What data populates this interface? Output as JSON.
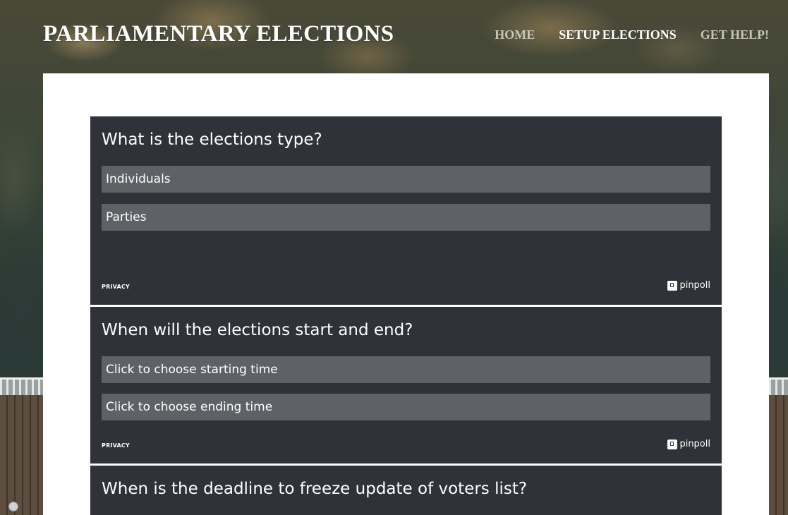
{
  "header": {
    "title": "PARLIAMENTARY ELECTIONS",
    "nav": [
      {
        "label": "HOME",
        "active": false
      },
      {
        "label": "SETUP ELECTIONS",
        "active": true
      },
      {
        "label": "GET HELP!",
        "active": false
      }
    ]
  },
  "polls": [
    {
      "question": "What is the elections type?",
      "options": [
        "Individuals",
        "Parties"
      ],
      "privacy_label": "PRIVACY",
      "brand": "pinpoll"
    },
    {
      "question": "When will the elections start and end?",
      "options": [
        "Click to choose starting time",
        "Click to choose ending time"
      ],
      "privacy_label": "PRIVACY",
      "brand": "pinpoll"
    },
    {
      "question": "When is the deadline to freeze update of voters list?"
    }
  ],
  "colors": {
    "poll_bg": "#2f3238",
    "option_bg": "#5f6166",
    "nav_inactive": "#c9c6b8",
    "nav_active": "#ffffff"
  }
}
